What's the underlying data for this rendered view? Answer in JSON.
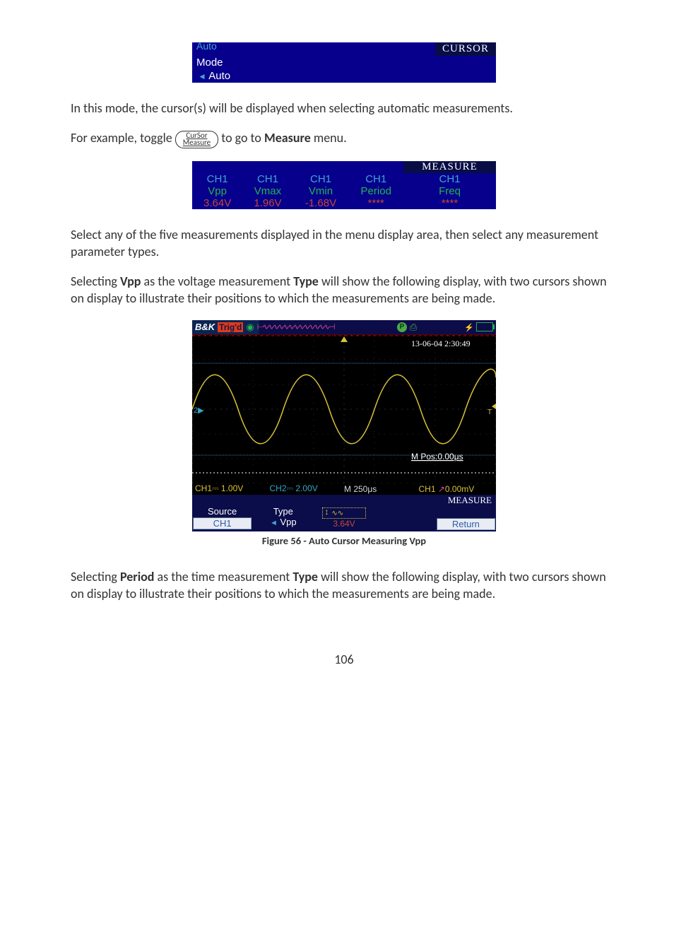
{
  "cursorMenu": {
    "cutoffLabel": "Auto",
    "title": "CURSOR",
    "row1": "Mode",
    "row2": "Auto"
  },
  "para1": "In this mode, the cursor(s) will be displayed when selecting automatic measurements.",
  "para2a": "For example, toggle ",
  "toggleBtn": {
    "line1": "CurSor",
    "line2": "Measure"
  },
  "para2b": " to go to ",
  "para2bold": "Measure",
  "para2c": " menu.",
  "measureMenu": {
    "title": "MEASURE",
    "cols": [
      {
        "ch": "CH1",
        "param": "Vpp",
        "val": "3.64V"
      },
      {
        "ch": "CH1",
        "param": "Vmax",
        "val": "1.96V"
      },
      {
        "ch": "CH1",
        "param": "Vmin",
        "val": "-1.68V"
      },
      {
        "ch": "CH1",
        "param": "Period",
        "val": "****"
      },
      {
        "ch": "CH1",
        "param": "Freq",
        "val": "****"
      }
    ]
  },
  "para3": "Select any of the five measurements displayed in the menu display area, then select any measurement parameter types.",
  "para4a": "Selecting ",
  "para4b": "Vpp",
  "para4c": " as the voltage measurement ",
  "para4d": "Type",
  "para4e": " will show the following display, with two cursors shown on display to illustrate their positions to which the measurements are being made.",
  "fig56": {
    "topbar": {
      "logo": "B&K",
      "trigd": "Trig'd",
      "circleP": "P",
      "timestamp": "13-06-04 2:30:49",
      "mpos": "M Pos:0.00μs"
    },
    "statusbar": {
      "ch1": "CH1⎓ 1.00V",
      "ch2": "CH2⎓ 2.00V",
      "m": "M 250μs",
      "trig": "CH1  0.00mV"
    },
    "measLabel": "MEASURE",
    "menubar": {
      "sourceLabel": "Source",
      "sourceVal": "CH1",
      "typeLabel": "Type",
      "typeVal": "Vpp",
      "vppVal": "3.64V",
      "returnLabel": "Return"
    }
  },
  "fig56Caption": "Figure 56 - Auto Cursor Measuring Vpp",
  "para5a": "Selecting ",
  "para5b": "Period",
  "para5c": " as the time measurement ",
  "para5d": "Type",
  "para5e": " will show the following display, with two cursors shown on display to illustrate their positions to which the measurements are being made.",
  "pageNumber": "106"
}
